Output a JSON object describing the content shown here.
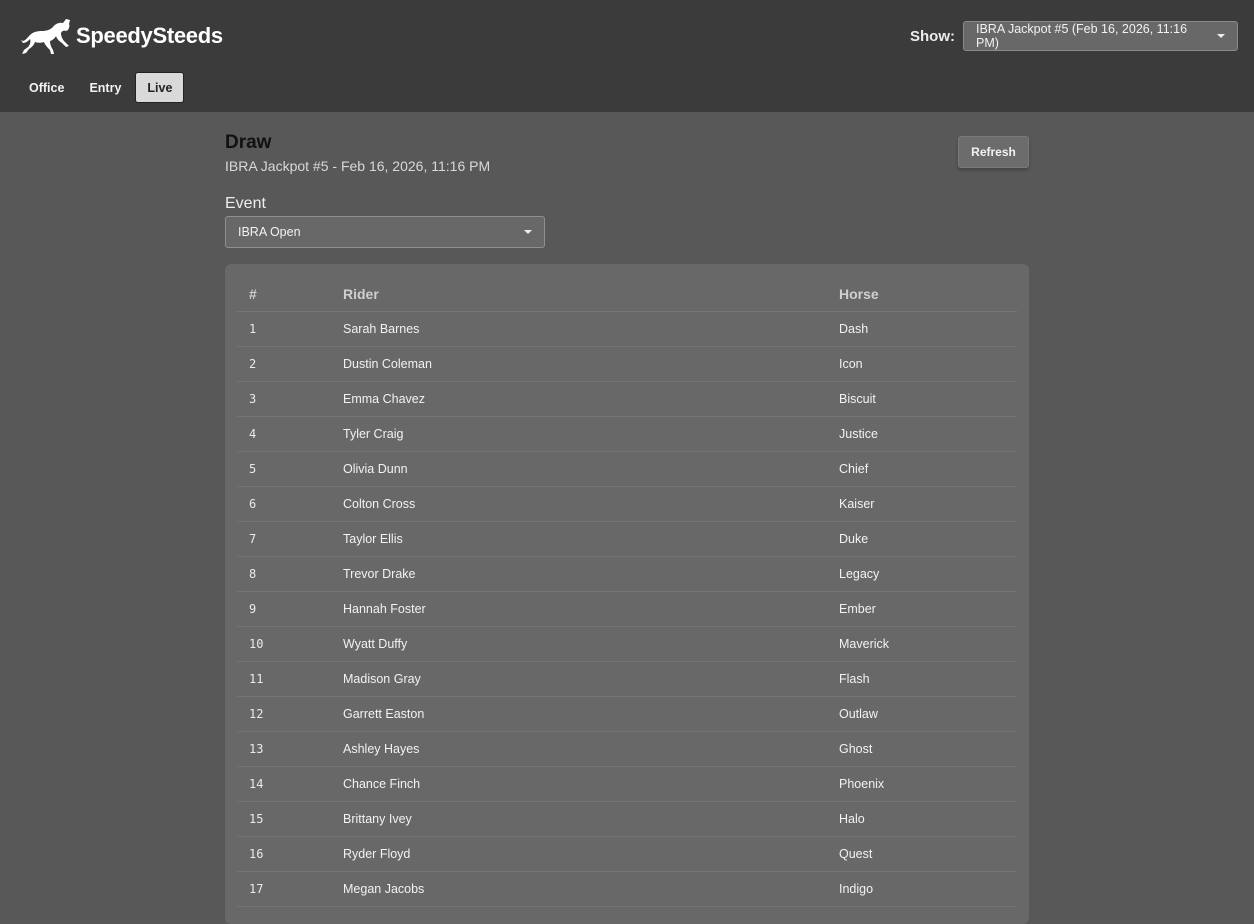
{
  "app": {
    "name": "SpeedySteeds"
  },
  "header": {
    "show_label": "Show:",
    "show_selected": "IBRA Jackpot #5 (Feb 16, 2026, 11:16 PM)",
    "nav": [
      {
        "label": "Office",
        "active": false
      },
      {
        "label": "Entry",
        "active": false
      },
      {
        "label": "Live",
        "active": true
      }
    ]
  },
  "main": {
    "title": "Draw",
    "subtitle": "IBRA Jackpot #5 - Feb 16, 2026, 11:16 PM",
    "refresh_label": "Refresh",
    "event_label": "Event",
    "event_selected": "IBRA Open"
  },
  "table": {
    "headers": {
      "num": "#",
      "rider": "Rider",
      "horse": "Horse"
    },
    "rows": [
      {
        "num": "1",
        "rider": "Sarah Barnes",
        "horse": "Dash"
      },
      {
        "num": "2",
        "rider": "Dustin Coleman",
        "horse": "Icon"
      },
      {
        "num": "3",
        "rider": "Emma Chavez",
        "horse": "Biscuit"
      },
      {
        "num": "4",
        "rider": "Tyler Craig",
        "horse": "Justice"
      },
      {
        "num": "5",
        "rider": "Olivia Dunn",
        "horse": "Chief"
      },
      {
        "num": "6",
        "rider": "Colton Cross",
        "horse": "Kaiser"
      },
      {
        "num": "7",
        "rider": "Taylor Ellis",
        "horse": "Duke"
      },
      {
        "num": "8",
        "rider": "Trevor Drake",
        "horse": "Legacy"
      },
      {
        "num": "9",
        "rider": "Hannah Foster",
        "horse": "Ember"
      },
      {
        "num": "10",
        "rider": "Wyatt Duffy",
        "horse": "Maverick"
      },
      {
        "num": "11",
        "rider": "Madison Gray",
        "horse": "Flash"
      },
      {
        "num": "12",
        "rider": "Garrett Easton",
        "horse": "Outlaw"
      },
      {
        "num": "13",
        "rider": "Ashley Hayes",
        "horse": "Ghost"
      },
      {
        "num": "14",
        "rider": "Chance Finch",
        "horse": "Phoenix"
      },
      {
        "num": "15",
        "rider": "Brittany Ivey",
        "horse": "Halo"
      },
      {
        "num": "16",
        "rider": "Ryder Floyd",
        "horse": "Quest"
      },
      {
        "num": "17",
        "rider": "Megan Jacobs",
        "horse": "Indigo"
      }
    ]
  },
  "icons": {
    "logo": "horse-icon",
    "dropdown": "caret-down-icon"
  },
  "colors": {
    "topbar": "#3b3b3b",
    "page": "#585858",
    "card": "#686868",
    "active_tab": "#d9d9d9"
  }
}
